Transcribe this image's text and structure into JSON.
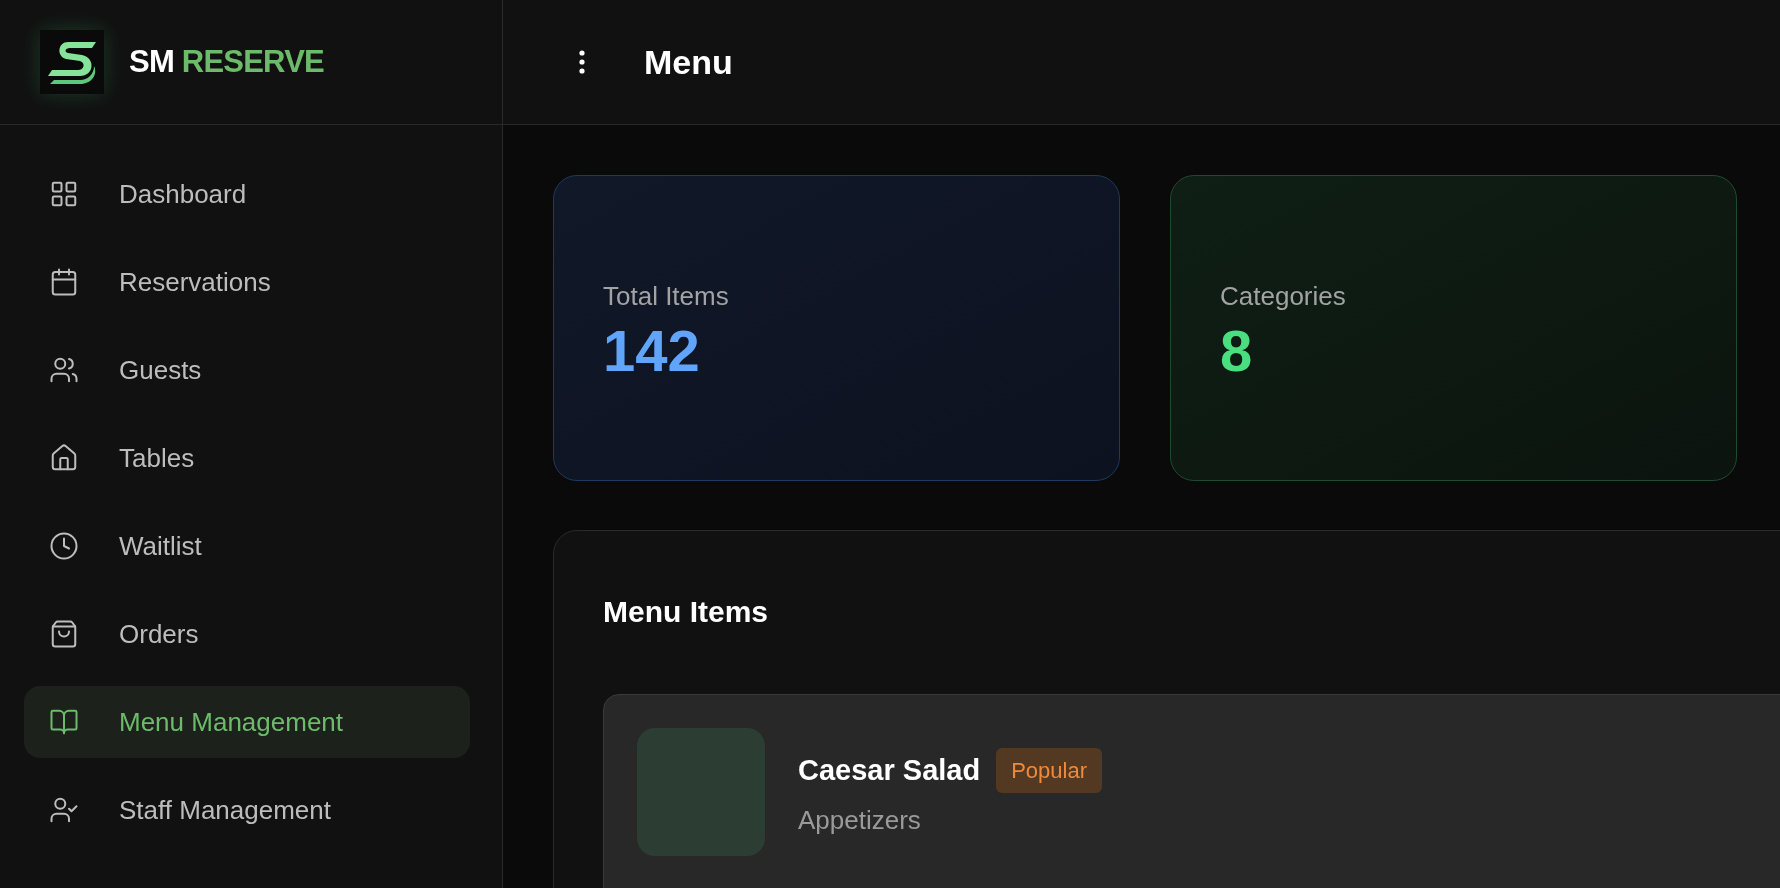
{
  "brand": {
    "name": "SM",
    "accent": "RESERVE"
  },
  "header": {
    "title": "Menu"
  },
  "sidebar": {
    "items": [
      {
        "label": "Dashboard",
        "selected": false
      },
      {
        "label": "Reservations",
        "selected": false
      },
      {
        "label": "Guests",
        "selected": false
      },
      {
        "label": "Tables",
        "selected": false
      },
      {
        "label": "Waitlist",
        "selected": false
      },
      {
        "label": "Orders",
        "selected": false
      },
      {
        "label": "Menu Management",
        "selected": true
      },
      {
        "label": "Staff Management",
        "selected": false
      }
    ]
  },
  "stats": [
    {
      "label": "Total Items",
      "value": "142",
      "color": "#60a5fa"
    },
    {
      "label": "Categories",
      "value": "8",
      "color": "#4ade80"
    }
  ],
  "menu_items": {
    "title": "Menu Items",
    "items": [
      {
        "name": "Caesar Salad",
        "badge": "Popular",
        "category": "Appetizers"
      }
    ]
  }
}
